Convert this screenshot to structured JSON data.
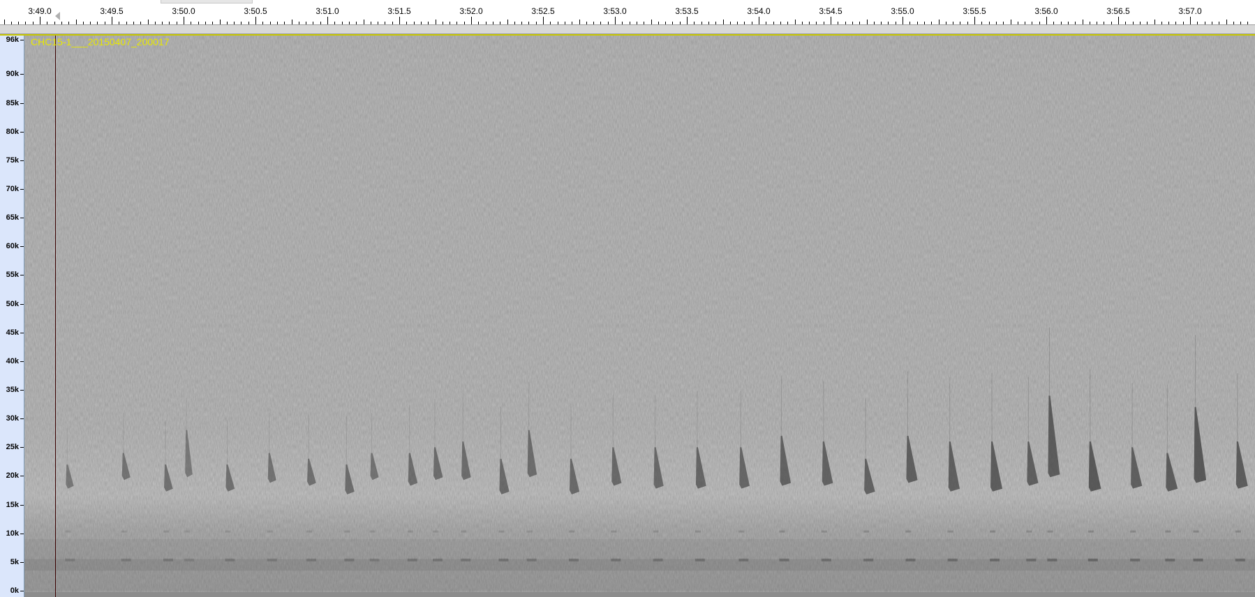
{
  "time_ruler": {
    "labels": [
      "3:49.0",
      "3:49.5",
      "3:50.0",
      "3:50.5",
      "3:51.0",
      "3:51.5",
      "3:52.0",
      "3:52.5",
      "3:53.0",
      "3:53.5",
      "3:54.0",
      "3:54.5",
      "3:55.0",
      "3:55.5",
      "3:56.0",
      "3:56.5",
      "3:57.0"
    ]
  },
  "frequency_axis": {
    "labels": [
      "96k",
      "90k",
      "85k",
      "80k",
      "75k",
      "70k",
      "65k",
      "60k",
      "55k",
      "50k",
      "45k",
      "40k",
      "35k",
      "30k",
      "25k",
      "20k",
      "15k",
      "10k",
      "5k",
      "0k"
    ]
  },
  "track": {
    "name": "CHC15-1___20150407_200017"
  },
  "spectrogram": {
    "view_start_seconds": 228.73,
    "view_end_seconds": 237.5,
    "calls": [
      {
        "time_s": 229.03,
        "top_khz": 22,
        "bottom_khz": 19,
        "strength": 0.45
      },
      {
        "time_s": 229.43,
        "top_khz": 24,
        "bottom_khz": 20.5,
        "strength": 0.5
      },
      {
        "time_s": 229.73,
        "top_khz": 22,
        "bottom_khz": 18.5,
        "strength": 0.55
      },
      {
        "time_s": 229.88,
        "top_khz": 28,
        "bottom_khz": 21,
        "strength": 0.4
      },
      {
        "time_s": 230.17,
        "top_khz": 22,
        "bottom_khz": 18.5,
        "strength": 0.55
      },
      {
        "time_s": 230.47,
        "top_khz": 24,
        "bottom_khz": 20,
        "strength": 0.5
      },
      {
        "time_s": 230.75,
        "top_khz": 23,
        "bottom_khz": 19.5,
        "strength": 0.55
      },
      {
        "time_s": 231.02,
        "top_khz": 22,
        "bottom_khz": 18,
        "strength": 0.6
      },
      {
        "time_s": 231.2,
        "top_khz": 24,
        "bottom_khz": 20.5,
        "strength": 0.5
      },
      {
        "time_s": 231.47,
        "top_khz": 24,
        "bottom_khz": 19.5,
        "strength": 0.6
      },
      {
        "time_s": 231.65,
        "top_khz": 25,
        "bottom_khz": 20.5,
        "strength": 0.6
      },
      {
        "time_s": 231.85,
        "top_khz": 26,
        "bottom_khz": 20.5,
        "strength": 0.6
      },
      {
        "time_s": 232.12,
        "top_khz": 23,
        "bottom_khz": 18,
        "strength": 0.65
      },
      {
        "time_s": 232.32,
        "top_khz": 28,
        "bottom_khz": 21,
        "strength": 0.6
      },
      {
        "time_s": 232.62,
        "top_khz": 23,
        "bottom_khz": 18,
        "strength": 0.65
      },
      {
        "time_s": 232.92,
        "top_khz": 25,
        "bottom_khz": 19.5,
        "strength": 0.65
      },
      {
        "time_s": 233.22,
        "top_khz": 25,
        "bottom_khz": 19,
        "strength": 0.65
      },
      {
        "time_s": 233.52,
        "top_khz": 25,
        "bottom_khz": 19,
        "strength": 0.7
      },
      {
        "time_s": 233.83,
        "top_khz": 25,
        "bottom_khz": 19,
        "strength": 0.7
      },
      {
        "time_s": 234.12,
        "top_khz": 27,
        "bottom_khz": 19.5,
        "strength": 0.75
      },
      {
        "time_s": 234.42,
        "top_khz": 26,
        "bottom_khz": 19.5,
        "strength": 0.75
      },
      {
        "time_s": 234.72,
        "top_khz": 23,
        "bottom_khz": 18,
        "strength": 0.75
      },
      {
        "time_s": 235.02,
        "top_khz": 27,
        "bottom_khz": 20,
        "strength": 0.8
      },
      {
        "time_s": 235.32,
        "top_khz": 26,
        "bottom_khz": 18.5,
        "strength": 0.8
      },
      {
        "time_s": 235.62,
        "top_khz": 26,
        "bottom_khz": 18.5,
        "strength": 0.85
      },
      {
        "time_s": 235.88,
        "top_khz": 26,
        "bottom_khz": 19.5,
        "strength": 0.8
      },
      {
        "time_s": 236.03,
        "top_khz": 34,
        "bottom_khz": 21,
        "strength": 0.85
      },
      {
        "time_s": 236.32,
        "top_khz": 26,
        "bottom_khz": 18.5,
        "strength": 0.9
      },
      {
        "time_s": 236.62,
        "top_khz": 25,
        "bottom_khz": 19,
        "strength": 0.8
      },
      {
        "time_s": 236.87,
        "top_khz": 24,
        "bottom_khz": 18.5,
        "strength": 0.85
      },
      {
        "time_s": 237.07,
        "top_khz": 32,
        "bottom_khz": 20,
        "strength": 0.9
      },
      {
        "time_s": 237.37,
        "top_khz": 26,
        "bottom_khz": 19,
        "strength": 0.85
      }
    ]
  },
  "colors": {
    "track_name": "#e8e800",
    "track_top_line": "#c8c800",
    "axis_background": "#dbe6fb",
    "spectrogram_background": "#b8b8b8",
    "call_color": "#3a3a3a"
  }
}
